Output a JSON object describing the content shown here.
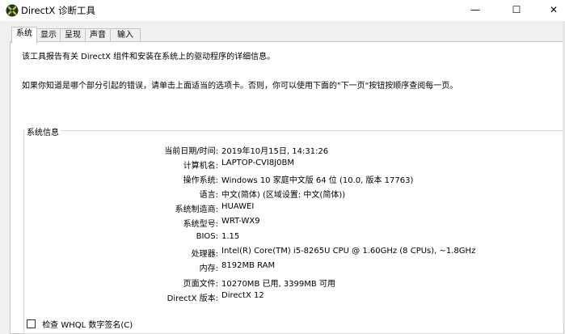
{
  "window": {
    "title": "DirectX 诊断工具",
    "minimize_glyph": "—",
    "maximize_glyph": "☐",
    "close_glyph": "✕",
    "icon": "directx-icon"
  },
  "tabs": [
    {
      "label": "系统",
      "active": true
    },
    {
      "label": "显示",
      "active": false
    },
    {
      "label": "呈现",
      "active": false
    },
    {
      "label": "声音",
      "active": false
    },
    {
      "label": "输入",
      "active": false
    }
  ],
  "intro": {
    "line1": "该工具报告有关 DirectX 组件和安装在系统上的驱动程序的详细信息。",
    "line2": "如果你知道是哪个部分引起的错误，请单击上面适当的选项卡。否则，你可以使用下面的\"下一页\"按钮按顺序查阅每一页。"
  },
  "system_info": {
    "legend": "系统信息",
    "rows": [
      {
        "label": "当前日期/时间:",
        "value": "2019年10月15日, 14:31:26"
      },
      {
        "label": "计算机名:",
        "value": "LAPTOP-CVI8J0BM"
      },
      {
        "label": "操作系统:",
        "value": "Windows 10 家庭中文版 64 位 (10.0, 版本 17763)"
      },
      {
        "label": "语言:",
        "value": "中文(简体) (区域设置: 中文(简体))"
      },
      {
        "label": "系统制造商:",
        "value": "HUAWEI"
      },
      {
        "label": "系统型号:",
        "value": "WRT-WX9"
      },
      {
        "label": "BIOS:",
        "value": "1.15"
      },
      {
        "label": "处理器:",
        "value": "Intel(R) Core(TM) i5-8265U CPU @ 1.60GHz (8 CPUs), ~1.8GHz"
      },
      {
        "label": "内存:",
        "value": "8192MB RAM"
      },
      {
        "label": "页面文件:",
        "value": "10270MB 已用, 3399MB 可用"
      },
      {
        "label": "DirectX 版本:",
        "value": "DirectX 12"
      }
    ]
  },
  "checkbox": {
    "label": "检查 WHQL 数字签名(C)",
    "checked": false
  }
}
